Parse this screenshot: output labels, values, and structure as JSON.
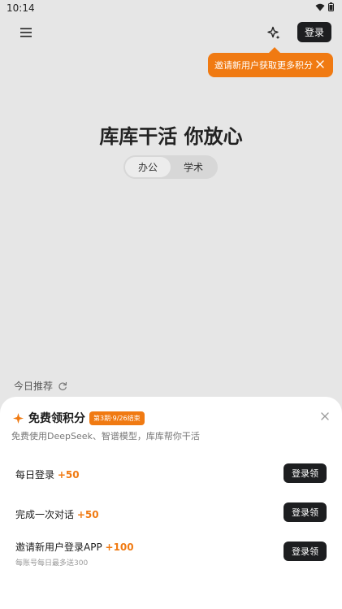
{
  "status_bar": {
    "time": "10:14"
  },
  "header": {
    "login_label": "登录"
  },
  "tooltip": {
    "text": "邀请新用户获取更多积分"
  },
  "hero": {
    "title": "库库干活 你放心"
  },
  "mode_tabs": [
    {
      "label": "办公",
      "active": true
    },
    {
      "label": "学术",
      "active": false
    }
  ],
  "today": {
    "label": "今日推荐"
  },
  "points_sheet": {
    "title": "免费领积分",
    "period_badge": "第3期·9/26结束",
    "subtitle": "免费使用DeepSeek、智谱模型，库库帮你干活",
    "tasks": [
      {
        "label": "每日登录",
        "points": "+50",
        "note": "",
        "button": "登录领"
      },
      {
        "label": "完成一次对话",
        "points": "+50",
        "note": "",
        "button": "登录领"
      },
      {
        "label": "邀请新用户登录APP",
        "points": "+100",
        "note": "每账号每日最多送300",
        "button": "登录领"
      }
    ]
  },
  "colors": {
    "accent": "#f07a12",
    "dark_button": "#1d1e20",
    "background": "#e6e6e6"
  }
}
